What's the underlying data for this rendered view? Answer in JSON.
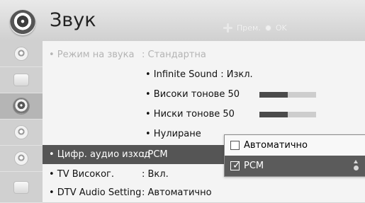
{
  "header": {
    "title": "Звук",
    "hint_move": "Прем.",
    "hint_ok": "OK"
  },
  "menu": {
    "rows": [
      {
        "label": "• Режим на звука",
        "value": ": Стандартна",
        "state": "disabled"
      },
      {
        "label": "• Цифр. аудио изход",
        "value": ": PCM",
        "state": "active"
      },
      {
        "label": "• TV Високог.",
        "value": ": Вкл.",
        "state": "normal"
      },
      {
        "label": "• DTV Audio Setting",
        "value": ": Автоматично",
        "state": "normal"
      }
    ],
    "subitems": [
      {
        "label": "• Infinite Sound : Изкл."
      },
      {
        "label": "• Високи тонове  50",
        "level": 50
      },
      {
        "label": "• Ниски тонове  50",
        "level": 50
      },
      {
        "label": "• Нулиране"
      }
    ]
  },
  "popup": {
    "options": [
      {
        "label": "Автоматично",
        "checked": false
      },
      {
        "label": "PCM",
        "checked": true
      }
    ]
  }
}
